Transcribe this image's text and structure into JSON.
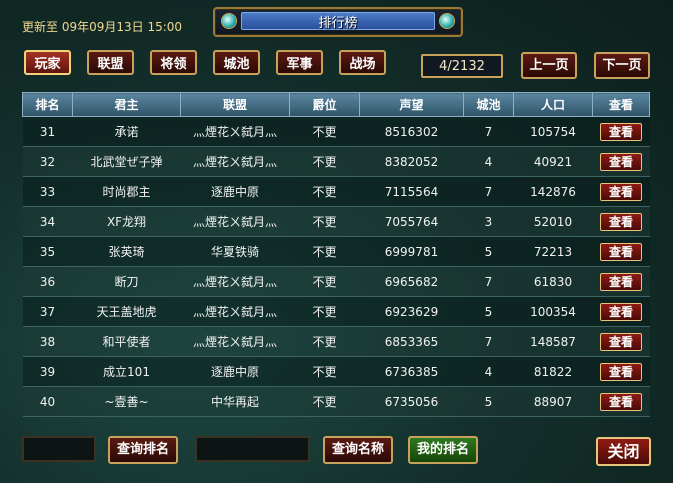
{
  "header": {
    "update_label": "更新至 09年09月13日 15:00",
    "title": "排行榜"
  },
  "tabs": [
    {
      "label": "玩家",
      "active": true
    },
    {
      "label": "联盟"
    },
    {
      "label": "将领"
    },
    {
      "label": "城池"
    },
    {
      "label": "军事"
    },
    {
      "label": "战场"
    }
  ],
  "pagination": {
    "page": "4/2132",
    "prev_label": "上一页",
    "next_label": "下一页"
  },
  "table": {
    "columns": [
      "排名",
      "君主",
      "联盟",
      "爵位",
      "声望",
      "城池",
      "人口",
      "查看"
    ],
    "view_label": "查看",
    "rows": [
      {
        "rank": "31",
        "lord": "承诺",
        "alliance": "灬煙花ㄨ弑月灬",
        "title": "不更",
        "prestige": "8516302",
        "cities": "7",
        "population": "105754"
      },
      {
        "rank": "32",
        "lord": "北武堂ぜ子弹",
        "alliance": "灬煙花ㄨ弑月灬",
        "title": "不更",
        "prestige": "8382052",
        "cities": "4",
        "population": "40921"
      },
      {
        "rank": "33",
        "lord": "时尚郡主",
        "alliance": "逐鹿中原",
        "title": "不更",
        "prestige": "7115564",
        "cities": "7",
        "population": "142876"
      },
      {
        "rank": "34",
        "lord": "XF龙翔",
        "alliance": "灬煙花ㄨ弑月灬",
        "title": "不更",
        "prestige": "7055764",
        "cities": "3",
        "population": "52010"
      },
      {
        "rank": "35",
        "lord": "张英琦",
        "alliance": "华夏铁骑",
        "title": "不更",
        "prestige": "6999781",
        "cities": "5",
        "population": "72213"
      },
      {
        "rank": "36",
        "lord": "断刀",
        "alliance": "灬煙花ㄨ弑月灬",
        "title": "不更",
        "prestige": "6965682",
        "cities": "7",
        "population": "61830"
      },
      {
        "rank": "37",
        "lord": "天王盖地虎",
        "alliance": "灬煙花ㄨ弑月灬",
        "title": "不更",
        "prestige": "6923629",
        "cities": "5",
        "population": "100354"
      },
      {
        "rank": "38",
        "lord": "和平使者",
        "alliance": "灬煙花ㄨ弑月灬",
        "title": "不更",
        "prestige": "6853365",
        "cities": "7",
        "population": "148587"
      },
      {
        "rank": "39",
        "lord": "成立101",
        "alliance": "逐鹿中原",
        "title": "不更",
        "prestige": "6736385",
        "cities": "4",
        "population": "81822"
      },
      {
        "rank": "40",
        "lord": "~壹善~",
        "alliance": "中华再起",
        "title": "不更",
        "prestige": "6735056",
        "cities": "5",
        "population": "88907"
      }
    ]
  },
  "footer": {
    "query_rank_label": "查询排名",
    "query_name_label": "查询名称",
    "my_rank_label": "我的排名",
    "close_label": "关闭"
  }
}
